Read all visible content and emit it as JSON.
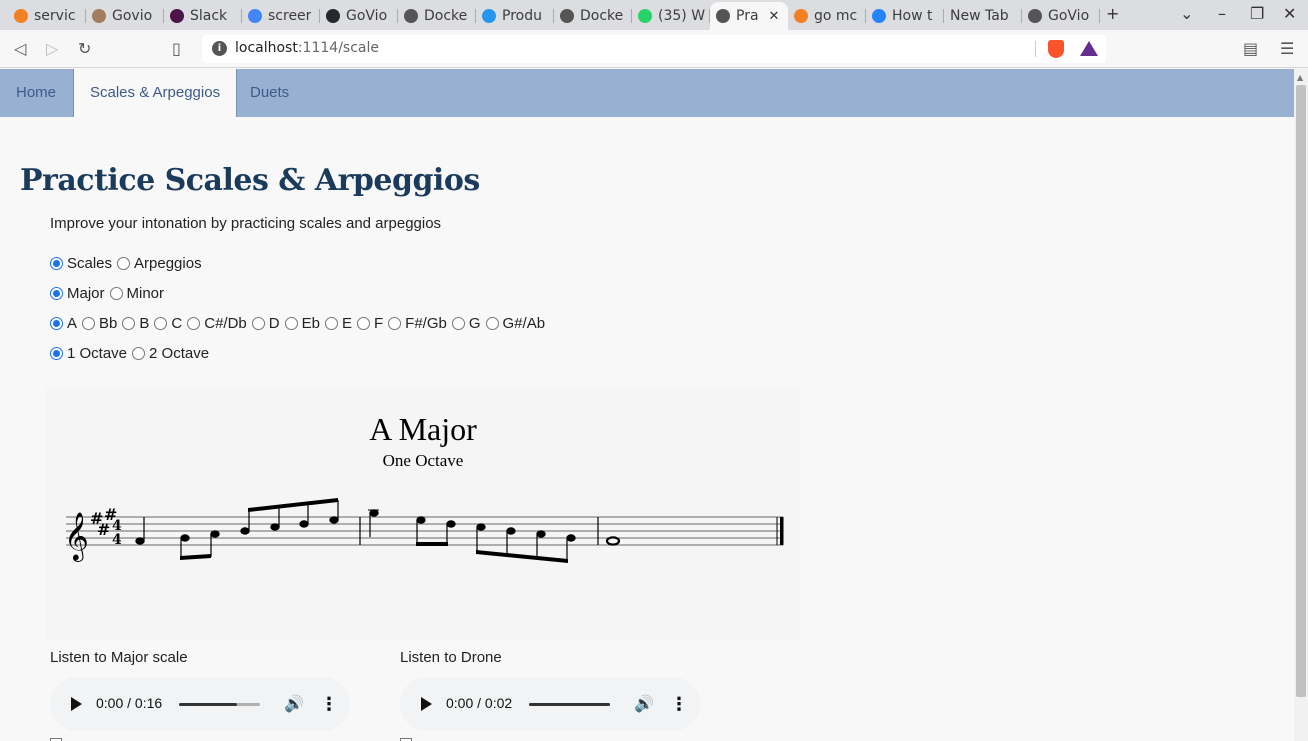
{
  "browser": {
    "tabs": [
      {
        "title": "servic",
        "icon": "stackoverflow-icon",
        "color": "#f48024"
      },
      {
        "title": "Govio",
        "icon": "avatar-icon",
        "color": "#a57d5c"
      },
      {
        "title": "Slack",
        "icon": "slack-icon",
        "color": "#4a154b"
      },
      {
        "title": "screer",
        "icon": "google-icon",
        "color": "#4285f4"
      },
      {
        "title": "GoVio",
        "icon": "github-icon",
        "color": "#24292e"
      },
      {
        "title": "Docke",
        "icon": "globe-icon",
        "color": "#555555"
      },
      {
        "title": "Produ",
        "icon": "docker-icon",
        "color": "#2496ed"
      },
      {
        "title": "Docke",
        "icon": "globe-icon",
        "color": "#555555"
      },
      {
        "title": "(35) W",
        "icon": "whatsapp-icon",
        "color": "#25d366"
      },
      {
        "title": "Pra",
        "icon": "globe-icon",
        "color": "#555555",
        "active": true
      },
      {
        "title": "go mc",
        "icon": "stackoverflow-icon",
        "color": "#f48024"
      },
      {
        "title": "How t",
        "icon": "confluence-icon",
        "color": "#2684ff"
      },
      {
        "title": "New Tab",
        "icon": "",
        "color": ""
      },
      {
        "title": "GoVio",
        "icon": "globe-icon",
        "color": "#555555"
      }
    ],
    "url_host": "localhost",
    "url_path": ":1114/scale"
  },
  "nav": {
    "items": [
      "Home",
      "Scales & Arpeggios",
      "Duets"
    ]
  },
  "page": {
    "title": "Practice Scales & Arpeggios",
    "lead": "Improve your intonation by practicing scales and arpeggios"
  },
  "options": {
    "type": [
      "Scales",
      "Arpeggios"
    ],
    "tonality": [
      "Major",
      "Minor"
    ],
    "keys": [
      "A",
      "Bb",
      "B",
      "C",
      "C#/Db",
      "D",
      "Eb",
      "E",
      "F",
      "F#/Gb",
      "G",
      "G#/Ab"
    ],
    "octaves": [
      "1 Octave",
      "2 Octave"
    ],
    "selected": {
      "type": "Scales",
      "tonality": "Major",
      "key": "A",
      "octaves": "1 Octave"
    }
  },
  "score": {
    "title": "A Major",
    "subtitle": "One Octave",
    "time_signature_top": "4",
    "time_signature_bottom": "4"
  },
  "audio": {
    "scale": {
      "label": "Listen to Major scale",
      "time": "0:00 / 0:16",
      "volume_level": 0.72
    },
    "drone": {
      "label": "Listen to Drone",
      "time": "0:00 / 0:02",
      "volume_level": 1.0
    }
  },
  "colors": {
    "nav_bg": "#98b0d2",
    "title": "#1a3b5c",
    "accent": "#1a73e8"
  }
}
